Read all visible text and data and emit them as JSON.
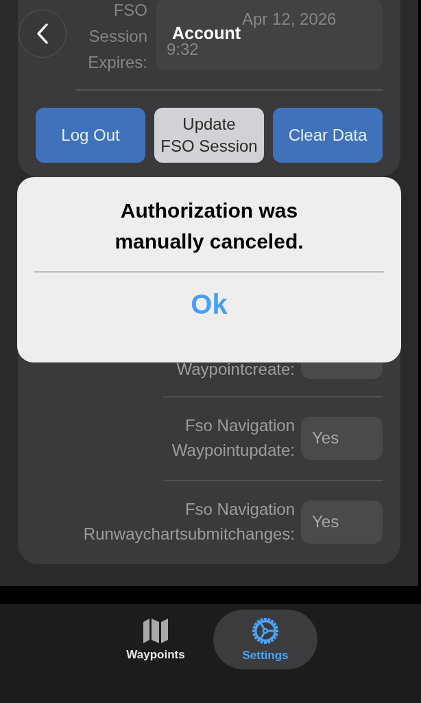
{
  "header": {
    "title": "Account"
  },
  "session": {
    "label_lines": [
      "FSO",
      "Session",
      "Expires:"
    ],
    "value_lines": [
      "Apr 12, 2026",
      "9:32"
    ]
  },
  "actions": [
    {
      "label_lines": [
        "Log Out"
      ],
      "kind": "primary"
    },
    {
      "label_lines": [
        "Update",
        "FSO Session"
      ],
      "kind": "secondary"
    },
    {
      "label_lines": [
        "Clear Data"
      ],
      "kind": "primary"
    }
  ],
  "permissions": [
    {
      "label_lines": [
        "Waypointcreate:"
      ]
    },
    {
      "label_lines": [
        "Fso Navigation",
        "Waypointupdate:"
      ],
      "value": "Yes"
    },
    {
      "label_lines": [
        "Fso Navigation",
        "Runwaychartsubmitchanges:"
      ],
      "value": "Yes"
    }
  ],
  "alert": {
    "message_lines": [
      "Authorization was",
      "manually canceled."
    ],
    "button": "Ok"
  },
  "tabs": [
    {
      "label": "Waypoints",
      "kind": "map",
      "selected": false
    },
    {
      "label": "Settings",
      "kind": "gear",
      "selected": true
    }
  ]
}
